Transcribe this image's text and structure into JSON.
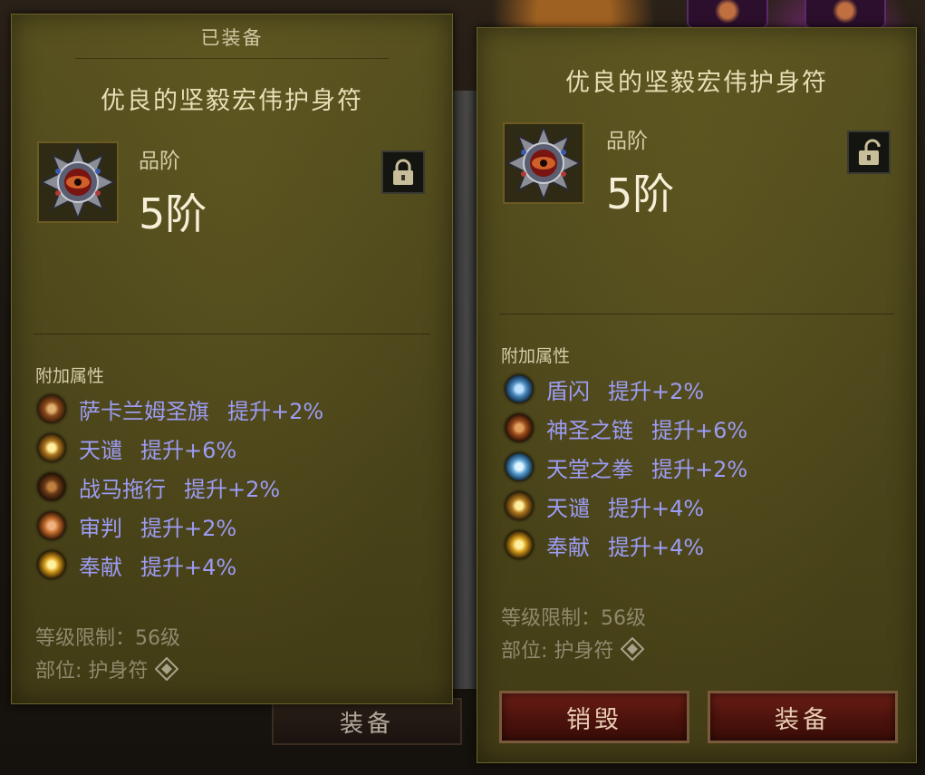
{
  "comparison_panel": {
    "equipped_label": "已装备",
    "item_name": "优良的坚毅宏伟护身符",
    "icon": "amulet-icon",
    "rank_label": "品阶",
    "rank_value": "5阶",
    "lock": "lock-closed-icon",
    "attributes_header": "附加属性",
    "attributes": [
      {
        "name": "萨卡兰姆圣旗",
        "value": "提升+2%",
        "icon": "banner-skill-icon",
        "color": "#8a4a1c"
      },
      {
        "name": "天谴",
        "value": "提升+6%",
        "icon": "fist-skill-icon",
        "color": "#b07820"
      },
      {
        "name": "战马拖行",
        "value": "提升+2%",
        "icon": "horse-skill-icon",
        "color": "#6a3a16"
      },
      {
        "name": "审判",
        "value": "提升+2%",
        "icon": "judgment-skill-icon",
        "color": "#c06a2a"
      },
      {
        "name": "奉献",
        "value": "提升+4%",
        "icon": "consecration-skill-icon",
        "color": "#d49a1a"
      }
    ],
    "level_req": "等级限制：56级",
    "slot": "部位: 护身符"
  },
  "new_item_panel": {
    "item_name": "优良的坚毅宏伟护身符",
    "icon": "amulet-icon",
    "rank_label": "品阶",
    "rank_value": "5阶",
    "lock": "lock-open-icon",
    "attributes_header": "附加属性",
    "attributes": [
      {
        "name": "盾闪",
        "value": "提升+2%",
        "icon": "shield-skill-icon",
        "color": "#4a8ac0"
      },
      {
        "name": "神圣之链",
        "value": "提升+6%",
        "icon": "chain-skill-icon",
        "color": "#9a4a1a"
      },
      {
        "name": "天堂之拳",
        "value": "提升+2%",
        "icon": "heaven-fist-skill-icon",
        "color": "#5aa0d4"
      },
      {
        "name": "天谴",
        "value": "提升+4%",
        "icon": "fist-skill-icon",
        "color": "#b07820"
      },
      {
        "name": "奉献",
        "value": "提升+4%",
        "icon": "consecration-skill-icon",
        "color": "#d49a1a"
      }
    ],
    "level_req": "等级限制：56级",
    "slot": "部位: 护身符",
    "salvage_button": "销毁",
    "equip_button": "装备"
  },
  "background_button": "装备"
}
